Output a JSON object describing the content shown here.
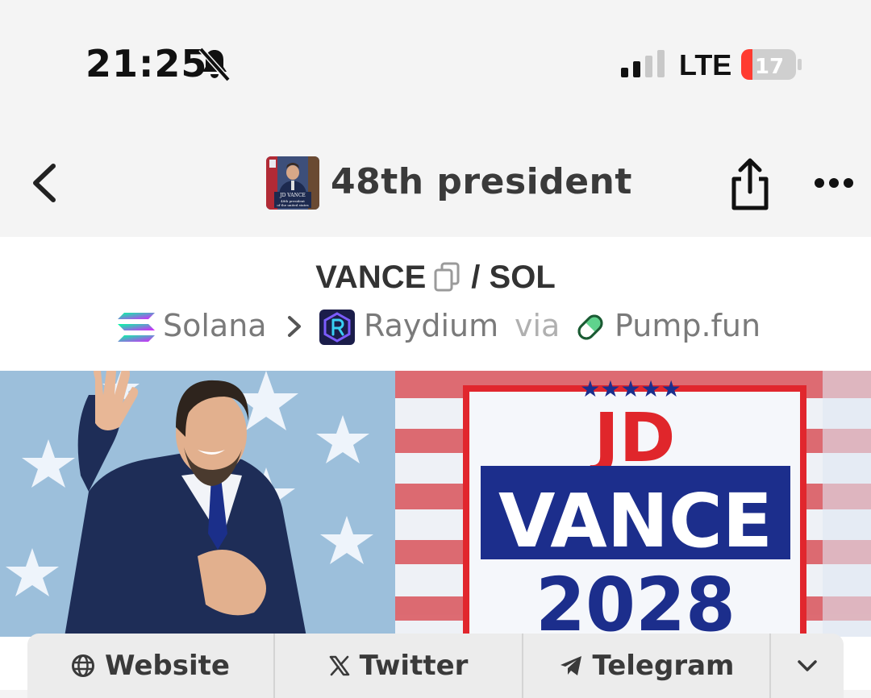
{
  "status_bar": {
    "time": "21:25",
    "network": "LTE",
    "battery": "17",
    "icons": [
      "bell-slash-icon",
      "cellular-signal-icon",
      "battery-charging-icon"
    ]
  },
  "nav": {
    "title": "48th president",
    "back_icon": "chevron-left-icon",
    "share_icon": "share-icon",
    "more_icon": "ellipsis-icon",
    "thumb_text": [
      "JD VANCE",
      "48th president",
      "of the united states"
    ]
  },
  "token": {
    "base": "VANCE",
    "separator": "/",
    "quote": "SOL",
    "copy_icon": "copy-icon"
  },
  "route": {
    "chain": "Solana",
    "dex": "Raydium",
    "via": "via",
    "launchpad": "Pump.fun"
  },
  "banner": {
    "line1": "JD",
    "line2": "VANCE",
    "line3": "2028",
    "stars": "★★★★★"
  },
  "links": {
    "website": "Website",
    "twitter": "Twitter",
    "telegram": "Telegram",
    "expand_icon": "chevron-down-icon"
  },
  "colors": {
    "accent_red": "#e0262b",
    "battery_red": "#ff3b30",
    "banner_blue": "#1c2e8c"
  }
}
